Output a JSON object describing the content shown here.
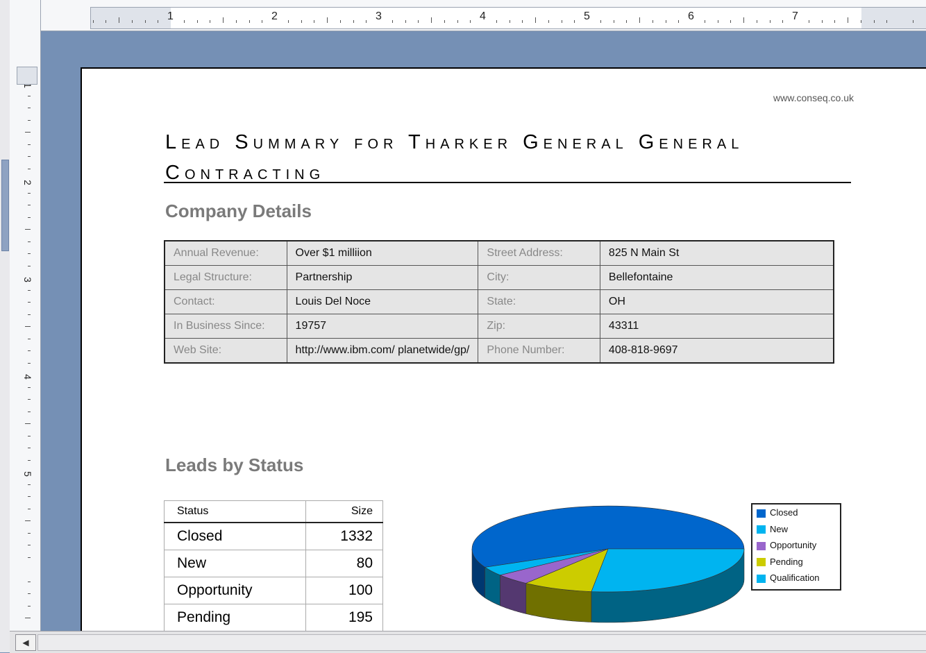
{
  "ruler": {
    "h_numbers": [
      "1",
      "2",
      "3",
      "4",
      "5",
      "6",
      "7"
    ],
    "v_numbers": [
      "1",
      "2",
      "3",
      "4",
      "5"
    ]
  },
  "header": {
    "url": "www.conseq.co.uk",
    "title": "Lead Summary for Tharker General General Contracting"
  },
  "company_details": {
    "heading": "Company Details",
    "rows": [
      {
        "l1": "Annual Revenue:",
        "v1": "Over $1 milliion",
        "l2": "Street Address:",
        "v2": "825 N Main St"
      },
      {
        "l1": "Legal Structure:",
        "v1": "Partnership",
        "l2": "City:",
        "v2": "Bellefontaine"
      },
      {
        "l1": "Contact:",
        "v1": "Louis Del Noce",
        "l2": "State:",
        "v2": "OH"
      },
      {
        "l1": "In Business Since:",
        "v1": "19757",
        "l2": "Zip:",
        "v2": "43311"
      },
      {
        "l1": "Web Site:",
        "v1": "http://www.ibm.com/ planetwide/gp/",
        "l2": "Phone Number:",
        "v2": "408-818-9697"
      }
    ]
  },
  "leads_by_status": {
    "heading": "Leads by Status",
    "columns": [
      "Status",
      "Size"
    ],
    "rows": [
      {
        "status": "Closed",
        "size": "1332"
      },
      {
        "status": "New",
        "size": "80"
      },
      {
        "status": "Opportunity",
        "size": "100"
      },
      {
        "status": "Pending",
        "size": "195"
      }
    ]
  },
  "chart_data": {
    "type": "pie",
    "categories": [
      "Closed",
      "New",
      "Opportunity",
      "Pending",
      "Qualification"
    ],
    "values": [
      1332,
      80,
      100,
      195,
      630
    ],
    "colors": [
      "#0066cc",
      "#00b4f0",
      "#9966cc",
      "#cccc00",
      "#00b4f0"
    ],
    "legend": "right"
  },
  "colors": {
    "workspace": "#7590b5",
    "closed": "#0066cc",
    "new": "#00b4f0",
    "opportunity": "#9966cc",
    "pending": "#cccc00",
    "qualification": "#00b4f0"
  },
  "icons": {
    "scroll_left": "triangle-left-icon"
  }
}
